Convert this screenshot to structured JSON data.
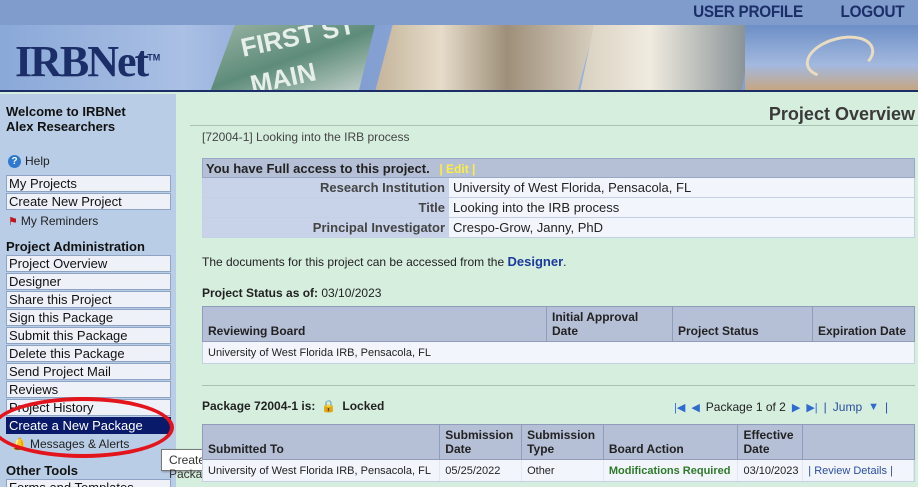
{
  "header": {
    "user_profile": "USER PROFILE",
    "logout": "LOGOUT",
    "logo_text": "IRBNet",
    "logo_tm": "TM",
    "banner_street_sign_1": "FIRST ST",
    "banner_street_sign_2": "MAIN"
  },
  "sidebar": {
    "welcome_line1": "Welcome to IRBNet",
    "welcome_line2": "Alex Researchers",
    "help": "Help",
    "my_projects": "My Projects",
    "create_new_project": "Create New Project",
    "my_reminders": "My Reminders",
    "project_admin_title": "Project Administration",
    "admin_items": [
      "Project Overview",
      "Designer",
      "Share this Project",
      "Sign this Package",
      "Submit this Package",
      "Delete this Package",
      "Send Project Mail",
      "Reviews",
      "Project History",
      "Create a New Package"
    ],
    "messages_alerts": "Messages & Alerts",
    "other_tools_title": "Other Tools",
    "forms_templates": "Forms and Templates"
  },
  "tooltip": "Create a New Package",
  "main": {
    "page_title": "Project Overview",
    "project_id_line": "[72004-1] Looking into the IRB process",
    "access_text": "You have Full access to this project.",
    "edit_label": "Edit",
    "details": [
      {
        "label": "Research Institution",
        "value": "University of West Florida, Pensacola, FL"
      },
      {
        "label": "Title",
        "value": "Looking into the IRB process"
      },
      {
        "label": "Principal Investigator",
        "value": "Crespo-Grow, Janny, PhD"
      }
    ],
    "docs_note_prefix": "The documents for this project can be accessed from the",
    "docs_note_link": "Designer",
    "status_as_label": "Project Status as of:",
    "status_as_date": "03/10/2023",
    "status_table": {
      "headers": [
        "Reviewing Board",
        "Initial Approval Date",
        "Project Status",
        "Expiration Date"
      ],
      "row": [
        "University of West Florida IRB, Pensacola, FL",
        "",
        "",
        ""
      ]
    },
    "package_label": "Package 72004-1 is:",
    "package_state": "Locked",
    "pager_text": "Package 1 of 2",
    "jump": "Jump",
    "package_table": {
      "headers": [
        "Submitted To",
        "Submission Date",
        "Submission Type",
        "Board Action",
        "Effective Date",
        ""
      ],
      "row": [
        "University of West Florida IRB, Pensacola, FL",
        "05/25/2022",
        "Other",
        "Modifications Required",
        "03/10/2023",
        "Review Details"
      ]
    }
  }
}
